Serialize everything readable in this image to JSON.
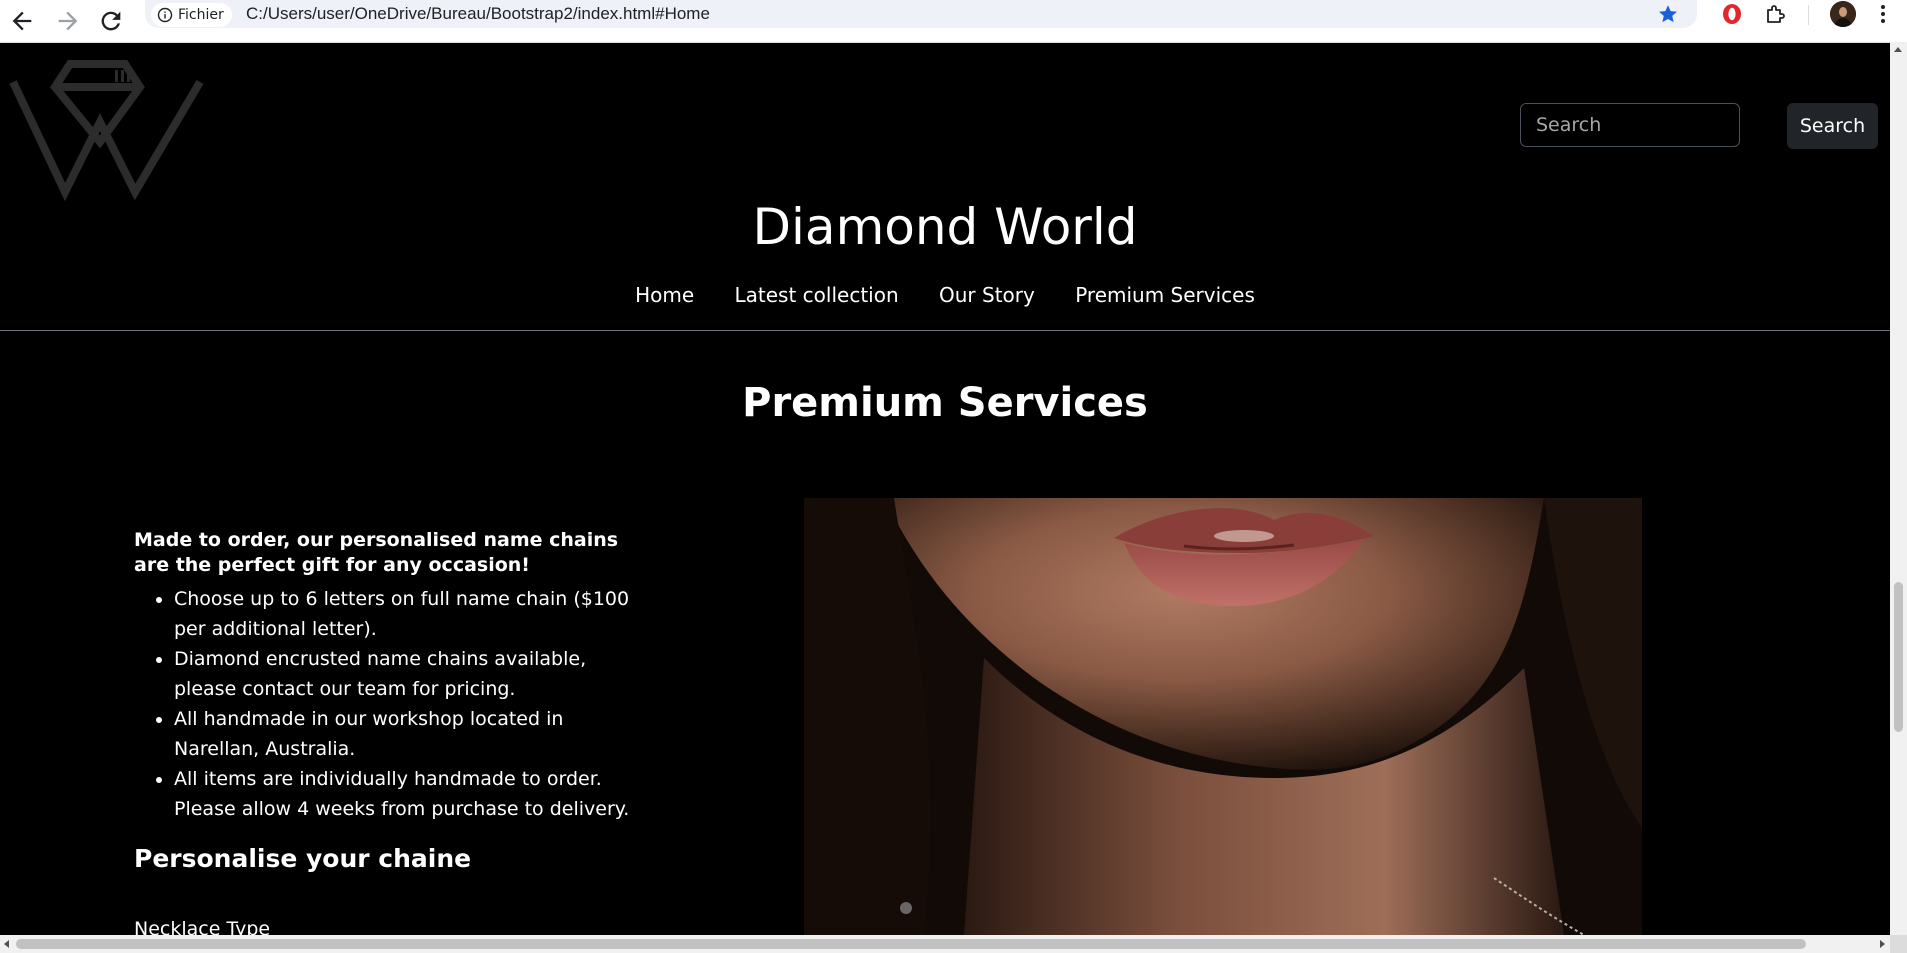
{
  "browser": {
    "file_chip_label": "Fichier",
    "url": "C:/Users/user/OneDrive/Bureau/Bootstrap2/index.html#Home",
    "icons": [
      "back-icon",
      "forward-icon",
      "reload-icon",
      "info-icon",
      "star-icon",
      "opera-icon",
      "puzzle-icon",
      "avatar",
      "menu-icon"
    ],
    "colors": {
      "star": "#1a5fd7",
      "opera": "#e3262a"
    }
  },
  "header": {
    "search_placeholder": "Search",
    "search_button": "Search",
    "site_title": "Diamond World",
    "nav": [
      "Home",
      "Latest collection",
      "Our Story",
      "Premium Services"
    ]
  },
  "main": {
    "section_title": "Premium Services",
    "intro": "Made to order, our personalised name chains are the perfect gift for any occasion!",
    "bullets": [
      "Choose up to 6 letters on full name chain ($100 per additional letter).",
      "Diamond encrusted name chains available, please contact our team for pricing.",
      "All handmade in our workshop located in Narellan, Australia.",
      "All items are individually handmade to order. Please allow 4 weeks from purchase to delivery."
    ],
    "subheading": "Personalise your chaine",
    "form_label": "Necklace Type"
  },
  "theme": {
    "background": "#000000",
    "text": "#ffffff",
    "button_bg": "#212529",
    "input_border": "#495057"
  }
}
